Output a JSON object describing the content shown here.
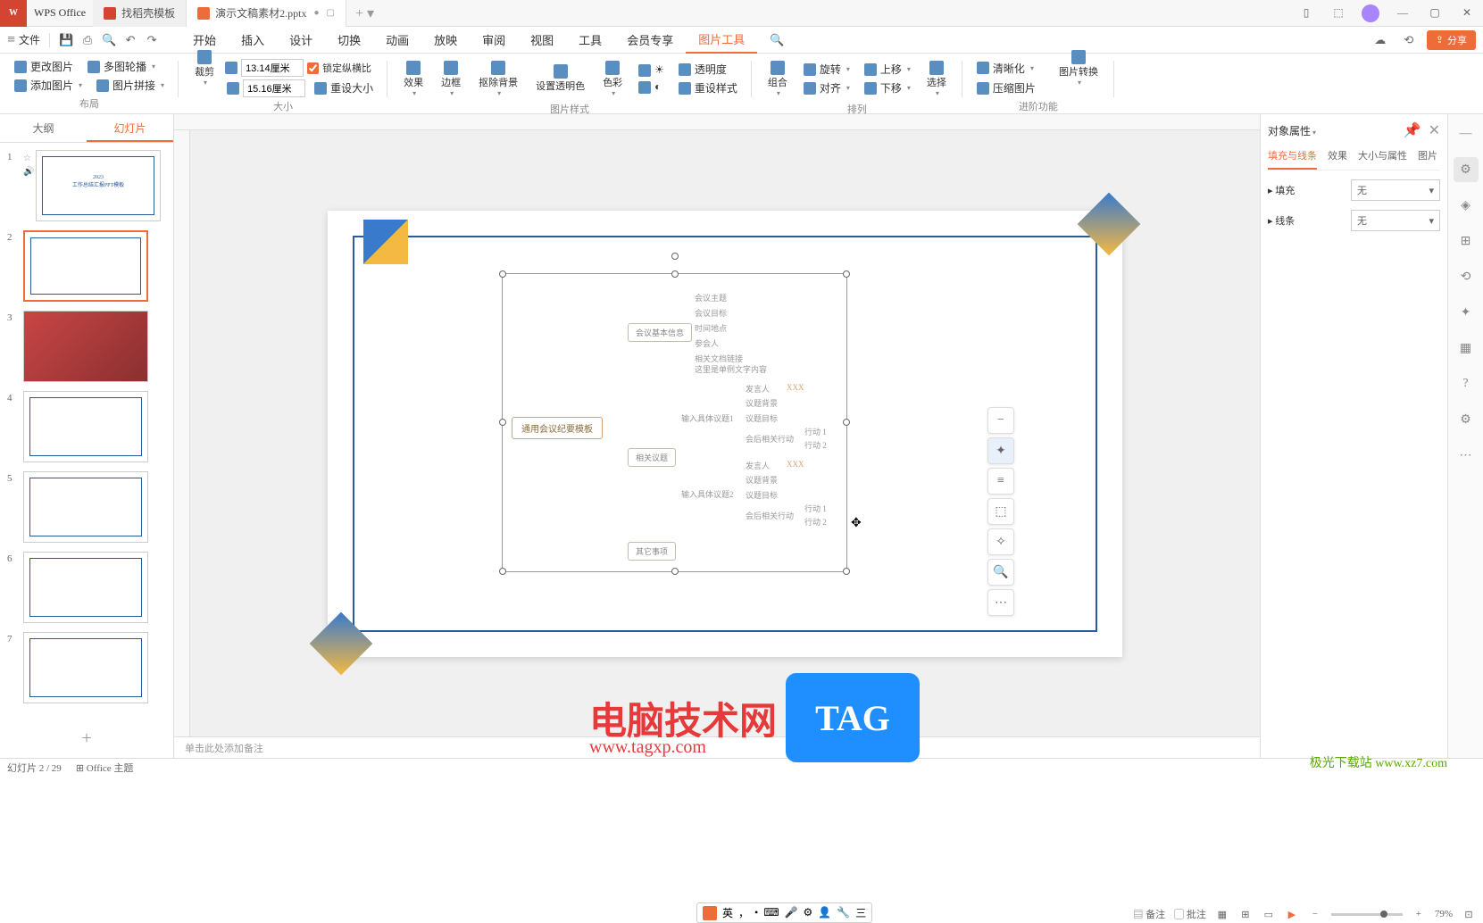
{
  "app": {
    "name": "WPS Office"
  },
  "tabs": [
    {
      "label": "找稻壳模板",
      "active": false
    },
    {
      "label": "演示文稿素材2.pptx",
      "active": true
    }
  ],
  "menu": {
    "file": "文件",
    "items": [
      "开始",
      "插入",
      "设计",
      "切换",
      "动画",
      "放映",
      "审阅",
      "视图",
      "工具",
      "会员专享",
      "图片工具"
    ],
    "active": "图片工具",
    "share": "分享"
  },
  "ribbon": {
    "layout": {
      "change_pic": "更改图片",
      "multi_carousel": "多图轮播",
      "add_pic": "添加图片",
      "pic_merge": "图片拼接",
      "label": "布局"
    },
    "size": {
      "crop": "裁剪",
      "width": "13.14厘米",
      "height": "15.16厘米",
      "lock_ratio": "锁定纵横比",
      "reset": "重设大小",
      "label": "大小"
    },
    "style": {
      "effect": "效果",
      "border": "边框",
      "remove_bg": "抠除背景",
      "set_transparent": "设置透明色",
      "color": "色彩",
      "transparency": "透明度",
      "reset_style": "重设样式",
      "label": "图片样式"
    },
    "arrange": {
      "combine": "组合",
      "rotate": "旋转",
      "align": "对齐",
      "up": "上移",
      "down": "下移",
      "select": "选择",
      "label": "排列"
    },
    "advanced": {
      "clarity": "清晰化",
      "compress": "压缩图片",
      "convert": "图片转换",
      "label": "进阶功能"
    }
  },
  "slides_panel": {
    "outline_tab": "大纲",
    "slides_tab": "幻灯片",
    "slides": [
      "1",
      "2",
      "3",
      "4",
      "5",
      "6",
      "7"
    ]
  },
  "mindmap": {
    "root": "通用会议纪要模板",
    "branch1": "会议基本信息",
    "branch1_items": [
      "会议主题",
      "会议目标",
      "时间地点",
      "参会人",
      "相关文档链接",
      "这里是单例文字内容"
    ],
    "branch2": "相关议题",
    "branch2_sub1": "输入具体议题1",
    "branch2_sub2": "输入具体议题2",
    "branch2_items": [
      "发言人",
      "议题背景",
      "议题目标",
      "会后相关行动"
    ],
    "xxx": "XXX",
    "action1": "行动 1",
    "action2": "行动 2",
    "branch3": "其它事项"
  },
  "props": {
    "title": "对象属性",
    "tabs": [
      "填充与线条",
      "效果",
      "大小与属性",
      "图片"
    ],
    "active_tab": "填充与线条",
    "fill": "填充",
    "line": "线条",
    "none": "无"
  },
  "notes": {
    "placeholder": "单击此处添加备注"
  },
  "status": {
    "slide_info": "幻灯片 2 / 29",
    "theme": "Office 主题",
    "notes_btn": "备注",
    "comments_btn": "批注",
    "zoom": "79%",
    "ime_lang": "英",
    "ime_char": "，"
  },
  "watermark": {
    "text": "电脑技术网",
    "url": "www.tagxp.com",
    "tag": "TAG",
    "corner": "极光下载站\nwww.xz7.com"
  }
}
